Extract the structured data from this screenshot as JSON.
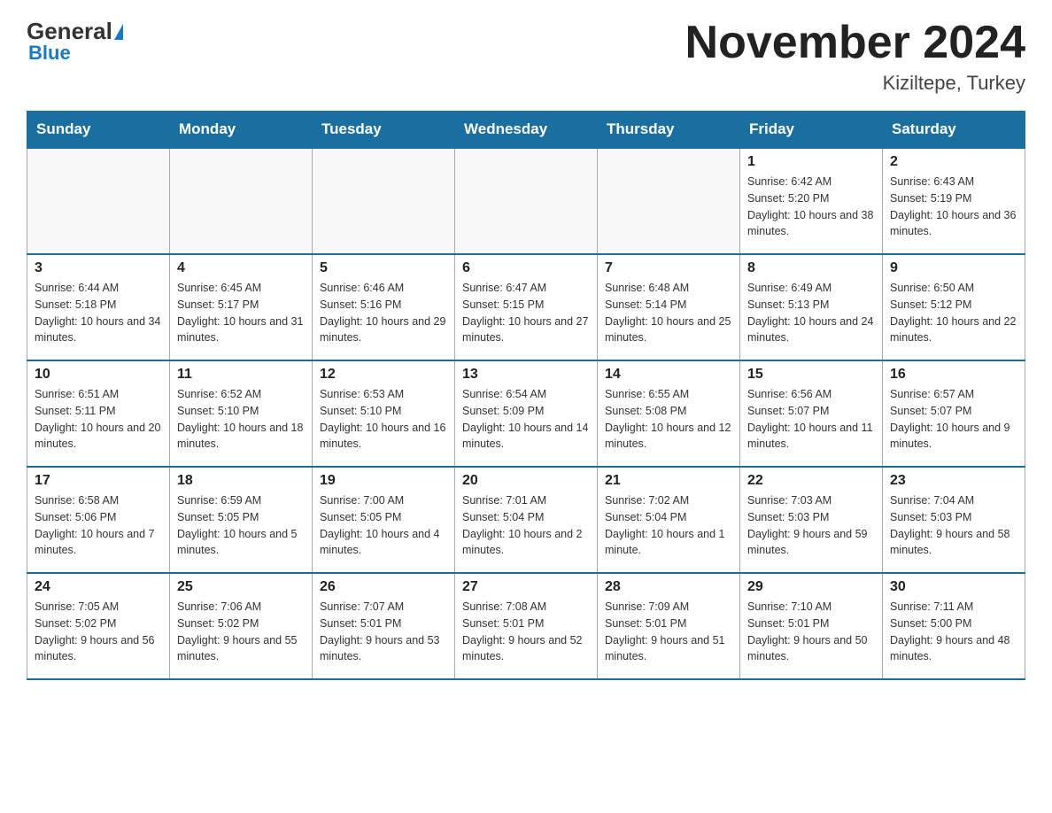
{
  "header": {
    "logo_text1": "General",
    "logo_text2": "Blue",
    "month_title": "November 2024",
    "location": "Kiziltepe, Turkey"
  },
  "weekdays": [
    "Sunday",
    "Monday",
    "Tuesday",
    "Wednesday",
    "Thursday",
    "Friday",
    "Saturday"
  ],
  "weeks": [
    [
      {
        "day": "",
        "info": ""
      },
      {
        "day": "",
        "info": ""
      },
      {
        "day": "",
        "info": ""
      },
      {
        "day": "",
        "info": ""
      },
      {
        "day": "",
        "info": ""
      },
      {
        "day": "1",
        "info": "Sunrise: 6:42 AM\nSunset: 5:20 PM\nDaylight: 10 hours and 38 minutes."
      },
      {
        "day": "2",
        "info": "Sunrise: 6:43 AM\nSunset: 5:19 PM\nDaylight: 10 hours and 36 minutes."
      }
    ],
    [
      {
        "day": "3",
        "info": "Sunrise: 6:44 AM\nSunset: 5:18 PM\nDaylight: 10 hours and 34 minutes."
      },
      {
        "day": "4",
        "info": "Sunrise: 6:45 AM\nSunset: 5:17 PM\nDaylight: 10 hours and 31 minutes."
      },
      {
        "day": "5",
        "info": "Sunrise: 6:46 AM\nSunset: 5:16 PM\nDaylight: 10 hours and 29 minutes."
      },
      {
        "day": "6",
        "info": "Sunrise: 6:47 AM\nSunset: 5:15 PM\nDaylight: 10 hours and 27 minutes."
      },
      {
        "day": "7",
        "info": "Sunrise: 6:48 AM\nSunset: 5:14 PM\nDaylight: 10 hours and 25 minutes."
      },
      {
        "day": "8",
        "info": "Sunrise: 6:49 AM\nSunset: 5:13 PM\nDaylight: 10 hours and 24 minutes."
      },
      {
        "day": "9",
        "info": "Sunrise: 6:50 AM\nSunset: 5:12 PM\nDaylight: 10 hours and 22 minutes."
      }
    ],
    [
      {
        "day": "10",
        "info": "Sunrise: 6:51 AM\nSunset: 5:11 PM\nDaylight: 10 hours and 20 minutes."
      },
      {
        "day": "11",
        "info": "Sunrise: 6:52 AM\nSunset: 5:10 PM\nDaylight: 10 hours and 18 minutes."
      },
      {
        "day": "12",
        "info": "Sunrise: 6:53 AM\nSunset: 5:10 PM\nDaylight: 10 hours and 16 minutes."
      },
      {
        "day": "13",
        "info": "Sunrise: 6:54 AM\nSunset: 5:09 PM\nDaylight: 10 hours and 14 minutes."
      },
      {
        "day": "14",
        "info": "Sunrise: 6:55 AM\nSunset: 5:08 PM\nDaylight: 10 hours and 12 minutes."
      },
      {
        "day": "15",
        "info": "Sunrise: 6:56 AM\nSunset: 5:07 PM\nDaylight: 10 hours and 11 minutes."
      },
      {
        "day": "16",
        "info": "Sunrise: 6:57 AM\nSunset: 5:07 PM\nDaylight: 10 hours and 9 minutes."
      }
    ],
    [
      {
        "day": "17",
        "info": "Sunrise: 6:58 AM\nSunset: 5:06 PM\nDaylight: 10 hours and 7 minutes."
      },
      {
        "day": "18",
        "info": "Sunrise: 6:59 AM\nSunset: 5:05 PM\nDaylight: 10 hours and 5 minutes."
      },
      {
        "day": "19",
        "info": "Sunrise: 7:00 AM\nSunset: 5:05 PM\nDaylight: 10 hours and 4 minutes."
      },
      {
        "day": "20",
        "info": "Sunrise: 7:01 AM\nSunset: 5:04 PM\nDaylight: 10 hours and 2 minutes."
      },
      {
        "day": "21",
        "info": "Sunrise: 7:02 AM\nSunset: 5:04 PM\nDaylight: 10 hours and 1 minute."
      },
      {
        "day": "22",
        "info": "Sunrise: 7:03 AM\nSunset: 5:03 PM\nDaylight: 9 hours and 59 minutes."
      },
      {
        "day": "23",
        "info": "Sunrise: 7:04 AM\nSunset: 5:03 PM\nDaylight: 9 hours and 58 minutes."
      }
    ],
    [
      {
        "day": "24",
        "info": "Sunrise: 7:05 AM\nSunset: 5:02 PM\nDaylight: 9 hours and 56 minutes."
      },
      {
        "day": "25",
        "info": "Sunrise: 7:06 AM\nSunset: 5:02 PM\nDaylight: 9 hours and 55 minutes."
      },
      {
        "day": "26",
        "info": "Sunrise: 7:07 AM\nSunset: 5:01 PM\nDaylight: 9 hours and 53 minutes."
      },
      {
        "day": "27",
        "info": "Sunrise: 7:08 AM\nSunset: 5:01 PM\nDaylight: 9 hours and 52 minutes."
      },
      {
        "day": "28",
        "info": "Sunrise: 7:09 AM\nSunset: 5:01 PM\nDaylight: 9 hours and 51 minutes."
      },
      {
        "day": "29",
        "info": "Sunrise: 7:10 AM\nSunset: 5:01 PM\nDaylight: 9 hours and 50 minutes."
      },
      {
        "day": "30",
        "info": "Sunrise: 7:11 AM\nSunset: 5:00 PM\nDaylight: 9 hours and 48 minutes."
      }
    ]
  ]
}
